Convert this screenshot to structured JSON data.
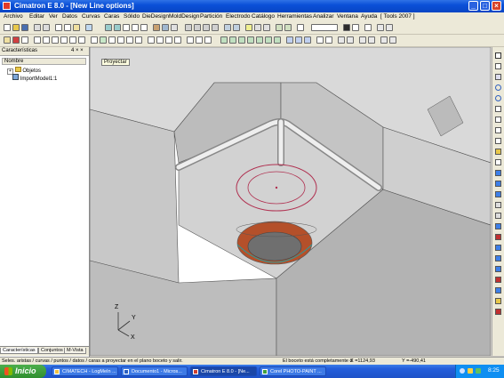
{
  "window": {
    "title": "Cimatron E 8.0 - [New Line options]",
    "min": "_",
    "max": "□",
    "close": "×"
  },
  "menu": {
    "items": [
      "Archivo",
      "Editar",
      "Ver",
      "Datos",
      "Curvas",
      "Caras",
      "Sólido",
      "DieDesign",
      "MoldDesign",
      "Partición",
      "Electrodo",
      "Catálogo",
      "Herramientas",
      "Analizar",
      "Ventana",
      "Ayuda",
      "[ Tools 2007 ]"
    ]
  },
  "panel": {
    "title": "Características",
    "pin": "4 × ×",
    "column_header": "Nombre",
    "tree": [
      {
        "label": "Objetos",
        "expander": "+"
      },
      {
        "label": "ImportModel1:1",
        "expander": ""
      }
    ],
    "tabs": [
      "Características",
      "Conjuntos",
      "M-Vista"
    ]
  },
  "viewport": {
    "tooltip": "Proyectar",
    "axis_labels": {
      "z": "Z",
      "y": "Y",
      "x": "X"
    }
  },
  "status": {
    "prompt": "Seles. aristas / curvas / puntos / datos / caras a proyectar en el plano boceto y salir.",
    "message": "El boceto está completamente d",
    "x": "X =1124,93",
    "y": "Y =-490,41"
  },
  "taskbar": {
    "start": "Inicio",
    "tasks": [
      "CIMATECH - LogMeIn ...",
      "Documento1 - Micros...",
      "Cimatron E 8.0 - [Ne...",
      "Corel PHOTO-PAINT ..."
    ],
    "clock": "8:25"
  },
  "colors": {
    "accent": "#0a50d8",
    "part_gray": "#c9c9c9",
    "circle_red": "#b03050",
    "rim_orange": "#b4502a",
    "circle_teal": "#2a9a9a"
  }
}
